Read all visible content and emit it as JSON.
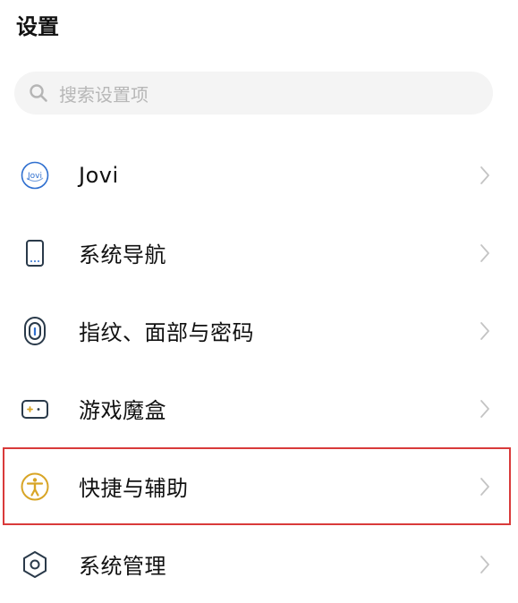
{
  "header": {
    "title": "设置"
  },
  "search": {
    "placeholder": "搜索设置项"
  },
  "settings": {
    "items": [
      {
        "label": "Jovi",
        "icon": "jovi-icon",
        "icon_text": "Jovi"
      },
      {
        "label": "系统导航",
        "icon": "phone-navigation-icon"
      },
      {
        "label": "指纹、面部与密码",
        "icon": "fingerprint-icon"
      },
      {
        "label": "游戏魔盒",
        "icon": "game-box-icon"
      },
      {
        "label": "快捷与辅助",
        "icon": "accessibility-icon",
        "highlighted": true
      },
      {
        "label": "系统管理",
        "icon": "system-management-icon"
      }
    ]
  },
  "colors": {
    "highlight_border": "#d93a3a",
    "accessibility_icon": "#d8a526",
    "search_background": "#f4f4f4",
    "chevron": "#c4c4c4"
  }
}
